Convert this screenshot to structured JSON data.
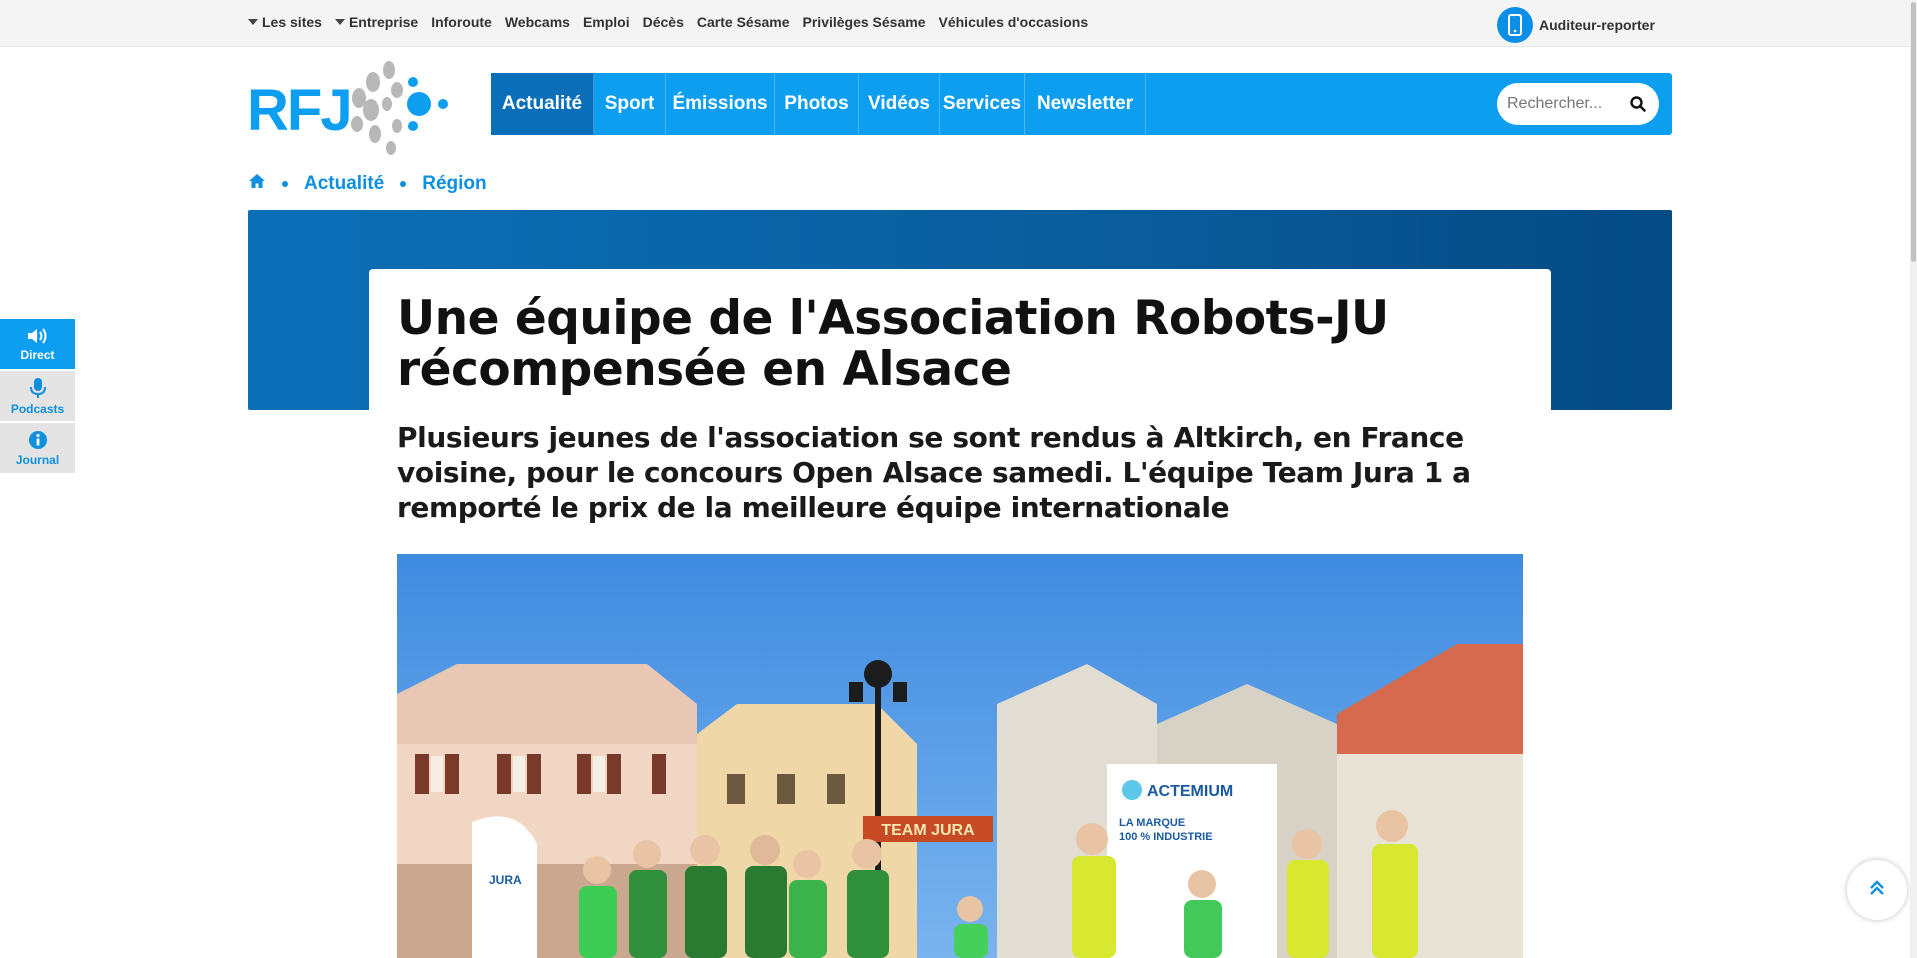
{
  "topbar": {
    "links": [
      {
        "label": "Les sites",
        "dropdown": true
      },
      {
        "label": "Entreprise",
        "dropdown": true
      },
      {
        "label": "Inforoute"
      },
      {
        "label": "Webcams"
      },
      {
        "label": "Emploi"
      },
      {
        "label": "Décès"
      },
      {
        "label": "Carte Sésame"
      },
      {
        "label": "Privilèges Sésame"
      },
      {
        "label": "Véhicules d'occasions"
      }
    ],
    "reporter_label": "Auditeur-reporter"
  },
  "logo": {
    "text": "RFJ"
  },
  "nav": {
    "items": [
      {
        "label": "Actualité",
        "active": true
      },
      {
        "label": "Sport"
      },
      {
        "label": "Émissions"
      },
      {
        "label": "Photos"
      },
      {
        "label": "Vidéos"
      },
      {
        "label": "Services"
      },
      {
        "label": "Newsletter"
      }
    ],
    "search_placeholder": "Rechercher..."
  },
  "breadcrumb": {
    "items": [
      "Actualité",
      "Région"
    ]
  },
  "article": {
    "title": "Une équipe de l'Association Robots-JU récompensée en Alsace",
    "lead": "Plusieurs jeunes de l'association se sont rendus à Altkirch, en France voisine, pour le concours Open Alsace samedi. L'équipe Team Jura 1 a remporté le prix de la meilleure équipe internationale",
    "photo_sign_team": "TEAM JURA",
    "photo_banner_brand": "ACTEMIUM",
    "photo_banner_line1": "LA MARQUE",
    "photo_banner_line2": "100 % INDUSTRIE",
    "photo_flag_text": "JURA"
  },
  "sidetabs": [
    {
      "label": "Direct",
      "icon": "speaker-icon"
    },
    {
      "label": "Podcasts",
      "icon": "microphone-icon"
    },
    {
      "label": "Journal",
      "icon": "info-icon"
    }
  ],
  "colors": {
    "brand_blue": "#0e9ef0",
    "nav_active": "#0a6fb8",
    "hero_blue": "#0a5d9c"
  }
}
